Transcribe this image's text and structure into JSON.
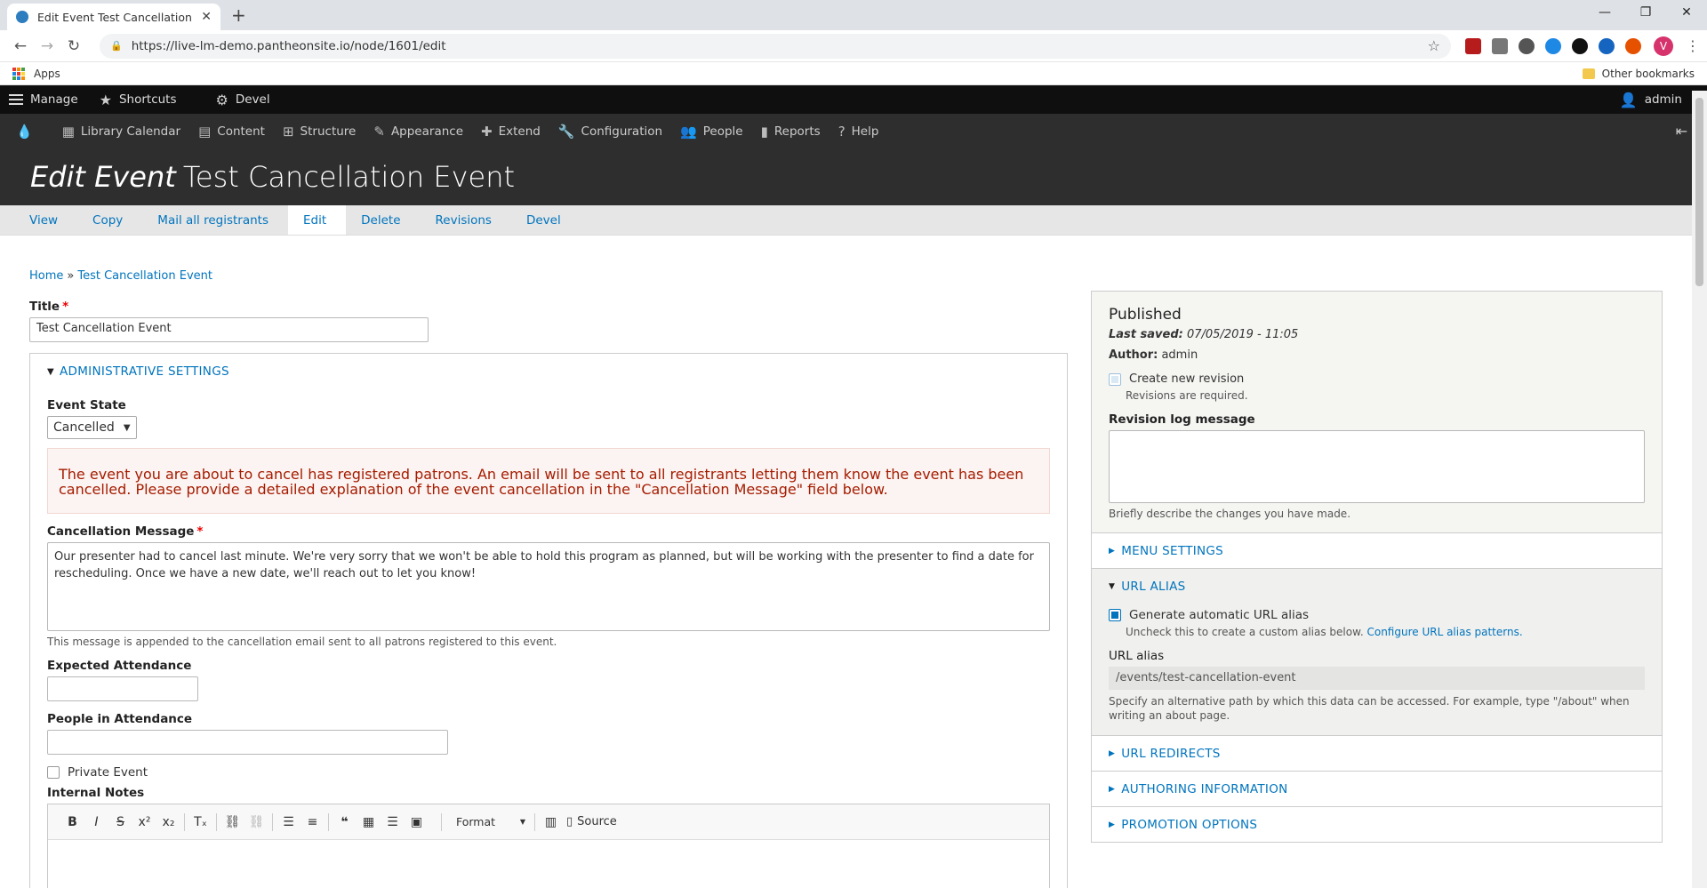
{
  "browser": {
    "tab_title": "Edit Event Test Cancellation Event",
    "url": "https://live-lm-demo.pantheonsite.io/node/1601/edit",
    "profile_initial": "V",
    "bookmarks_apps": "Apps",
    "bookmarks_other": "Other bookmarks"
  },
  "toolbar": {
    "manage": "Manage",
    "shortcuts": "Shortcuts",
    "devel": "Devel",
    "user": "admin",
    "menu": [
      "Library Calendar",
      "Content",
      "Structure",
      "Appearance",
      "Extend",
      "Configuration",
      "People",
      "Reports",
      "Help"
    ]
  },
  "page": {
    "title_prefix": "Edit Event",
    "title": "Test Cancellation Event",
    "tabs": [
      "View",
      "Copy",
      "Mail all registrants",
      "Edit",
      "Delete",
      "Revisions",
      "Devel"
    ],
    "active_tab": "Edit",
    "breadcrumb_home": "Home",
    "breadcrumb_sep": "»",
    "breadcrumb_current": "Test Cancellation Event"
  },
  "form": {
    "title_label": "Title",
    "title_value": "Test Cancellation Event",
    "admin_settings_label": "ADMINISTRATIVE SETTINGS",
    "event_state_label": "Event State",
    "event_state_value": "Cancelled",
    "alert_text": "The event you are about to cancel has registered patrons. An email will be sent to all registrants letting them know the event has been cancelled. Please provide a detailed explanation of the event cancellation in the \"Cancellation Message\" field below.",
    "cancel_msg_label": "Cancellation Message",
    "cancel_msg_value": "Our presenter had to cancel last minute. We're very sorry that we won't be able to hold this program as planned, but will be working with the presenter to find a date for rescheduling. Once we have a new date, we'll reach out to let you know!",
    "cancel_msg_desc": "This message is appended to the cancellation email sent to all patrons registered to this event.",
    "expected_label": "Expected Attendance",
    "expected_value": "",
    "people_label": "People in Attendance",
    "people_value": "",
    "private_label": "Private Event",
    "internal_label": "Internal Notes",
    "editor_format": "Format",
    "editor_source": "Source"
  },
  "sidebar": {
    "status": "Published",
    "last_saved_label": "Last saved:",
    "last_saved_value": "07/05/2019 - 11:05",
    "author_label": "Author:",
    "author_value": "admin",
    "create_revision": "Create new revision",
    "revisions_required": "Revisions are required.",
    "revlog_label": "Revision log message",
    "revlog_desc": "Briefly describe the changes you have made.",
    "menu_settings": "MENU SETTINGS",
    "url_alias_header": "URL ALIAS",
    "gen_alias": "Generate automatic URL alias",
    "gen_alias_desc": "Uncheck this to create a custom alias below.",
    "configure_link": "Configure URL alias patterns.",
    "url_alias_label": "URL alias",
    "url_alias_value": "/events/test-cancellation-event",
    "url_alias_desc": "Specify an alternative path by which this data can be accessed. For example, type \"/about\" when writing an about page.",
    "url_redirects": "URL REDIRECTS",
    "authoring": "AUTHORING INFORMATION",
    "promotion": "PROMOTION OPTIONS"
  },
  "colors": {
    "link": "#0074bd",
    "toolbar": "#0f0f0f",
    "header": "#2e2e2e",
    "alert": "#a51b00"
  }
}
